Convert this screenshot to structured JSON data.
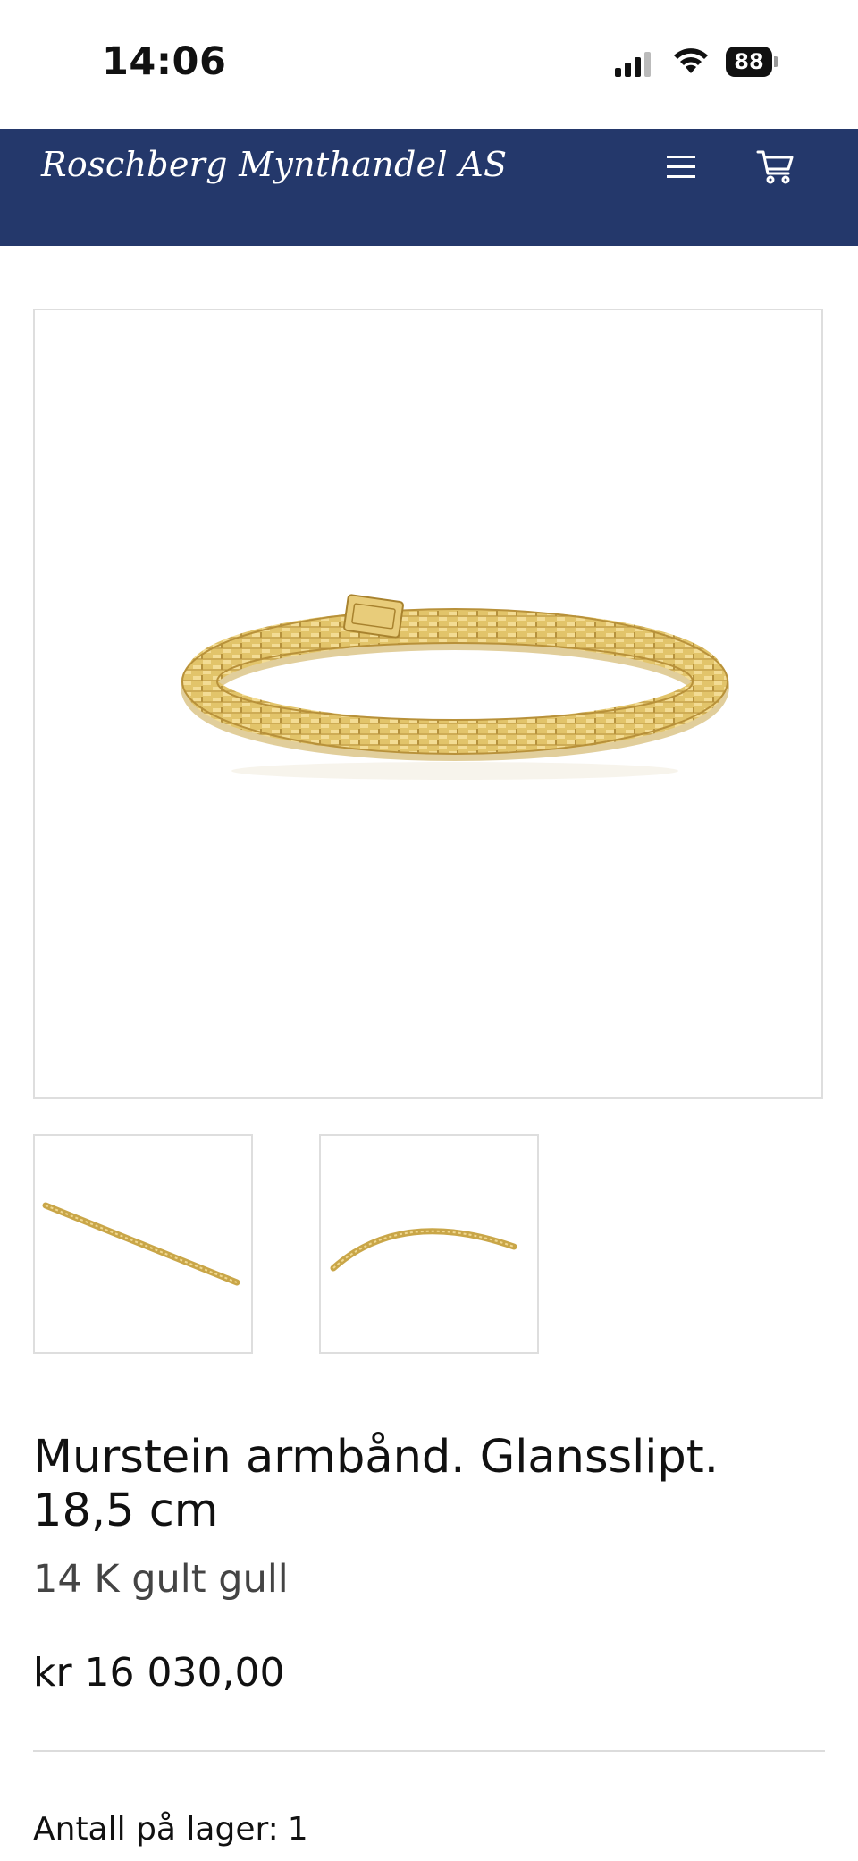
{
  "status_bar": {
    "time": "14:06",
    "battery": "88",
    "icons": [
      "cellular-signal-icon",
      "wifi-icon",
      "battery-icon"
    ]
  },
  "header": {
    "logo_text": "Roschberg Mynthandel AS",
    "background_color": "#24386b",
    "icons": [
      "hamburger-menu-icon",
      "shopping-cart-icon"
    ]
  },
  "gallery": {
    "thumbnails_count": 2
  },
  "product": {
    "title": "Murstein armbånd. Glansslipt. 18,5 cm",
    "subtitle": "14 K gult gull",
    "price": "kr 16 030,00",
    "stock_label": "Antall på lager:",
    "stock_value": "1"
  },
  "colors": {
    "gold": "#d9b85a",
    "text": "#111111",
    "muted_text": "#444444"
  }
}
